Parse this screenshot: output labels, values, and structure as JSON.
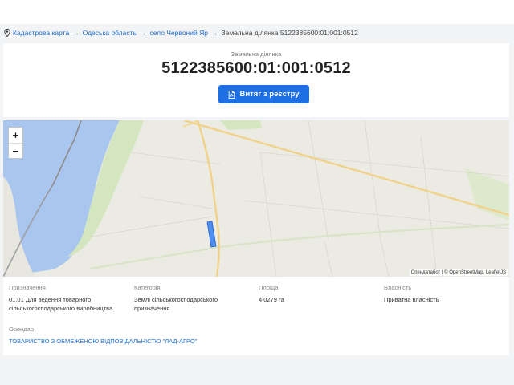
{
  "breadcrumb": {
    "icon": "map-pin-icon",
    "items": [
      "Кадастрова карта",
      "Одеська область",
      "село Червоний Яр"
    ],
    "separator": "→",
    "current": "Земельна ділянка 5122385600:01:001:0512"
  },
  "header": {
    "subtitle": "Земельна ділянка",
    "title": "5122385600:01:001:0512",
    "button_label": "Витяг з реєстру",
    "button_icon": "document-pdf-icon"
  },
  "map": {
    "zoom_in": "+",
    "zoom_out": "−",
    "attribution_sep": " | © ",
    "attribution_credit_1": "Опендатабот",
    "attribution_credit_2": "OpenStreetMap",
    "attribution_credit_3": "LeafletJS",
    "attribution_comma": ", ",
    "colors": {
      "water": "#a9c6ee",
      "land": "#ecebe3",
      "green": "#d4e6c0",
      "road": "#f3d795",
      "parcel": "#4d8ef0"
    }
  },
  "details": {
    "purpose_label": "Призначення",
    "purpose_line1": "01.01 Для ведення товарного",
    "purpose_line2": "сільськогосподарського виробництва",
    "category_label": "Категорія",
    "category_line1": "Землі сільськогосподарського",
    "category_line2": "призначення",
    "area_label": "Площа",
    "area_value": "4.0279 га",
    "ownership_label": "Власність",
    "ownership_value": "Приватна власність",
    "tenant_label": "Орендар",
    "tenant_value": "ТОВАРИСТВО З ОБМЕЖЕНОЮ ВІДПОВІДАЛЬНІСТЮ \"ЛАД-АГРО\""
  }
}
